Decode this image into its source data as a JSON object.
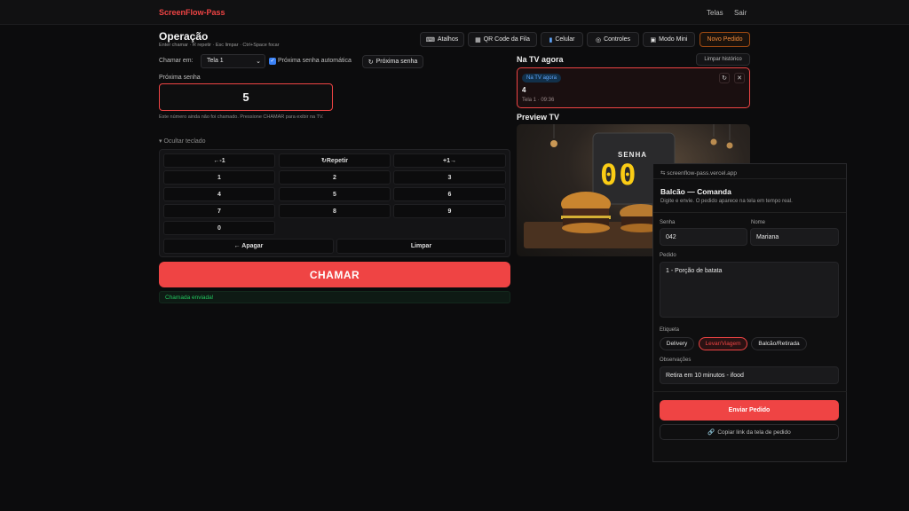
{
  "topbar": {
    "brand": "ScreenFlow-Pass",
    "link_telas": "Telas",
    "link_sair": "Sair"
  },
  "header": {
    "title": "Operação",
    "subtitle": "Enter chamar · R repetir · Esc limpar · Ctrl+Space focar",
    "buttons": {
      "atalhos": "Atalhos",
      "qr": "QR Code da Fila",
      "celular": "Celular",
      "controles": "Controles",
      "modo_mini": "Modo Mini",
      "novo_pedido": "Novo Pedido"
    }
  },
  "controls": {
    "chamar_em_label": "Chamar em:",
    "screen_selected": "Tela 1",
    "auto_label": "Próxima senha automática",
    "next_button": "Próxima senha"
  },
  "next": {
    "label": "Próxima senha",
    "value": "5",
    "hint": "Este número ainda não foi chamado. Pressione CHAMAR para exibir na TV."
  },
  "keypad": {
    "toggle": "Ocultar teclado",
    "minus": "←-1",
    "repeat": "↻Repetir",
    "plus": "+1→",
    "digits": [
      "1",
      "2",
      "3",
      "4",
      "5",
      "6",
      "7",
      "8",
      "9",
      "0"
    ],
    "backspace": "← Apagar",
    "clear": "Limpar"
  },
  "call": {
    "button": "CHAMAR",
    "status": "Chamada enviada!"
  },
  "tv_now": {
    "title": "Na TV agora",
    "clear_history": "Limpar histórico",
    "badge": "Na TV agora",
    "number": "4",
    "meta": "Tela 1 · 09:36"
  },
  "preview": {
    "title": "Preview TV",
    "senha_label": "SENHA",
    "digits": "00"
  },
  "modal": {
    "url": "screenflow-pass.vercel.app",
    "title": "Balcão — Comanda",
    "description": "Digite e envie. O pedido aparece na tela em tempo real.",
    "senha_label": "Senha",
    "senha_value": "042",
    "nome_label": "Nome",
    "nome_value": "Mariana",
    "pedido_label": "Pedido",
    "pedido_value": "1 - Porção de batata",
    "etiqueta_label": "Etiqueta",
    "chips": [
      "Delivery",
      "Levar/Viagem",
      "Balcão/Retirada"
    ],
    "obs_label": "Observações",
    "obs_value": "Retira em 10 minutos - ifood",
    "send_button": "Enviar Pedido",
    "copy_link": "Copiar link da tela de pedido"
  },
  "colors": {
    "accent": "#ef4444",
    "success": "#22c55e",
    "info": "#60a5fa",
    "orange": "#f28a3a",
    "digit_yellow": "#facc15"
  }
}
